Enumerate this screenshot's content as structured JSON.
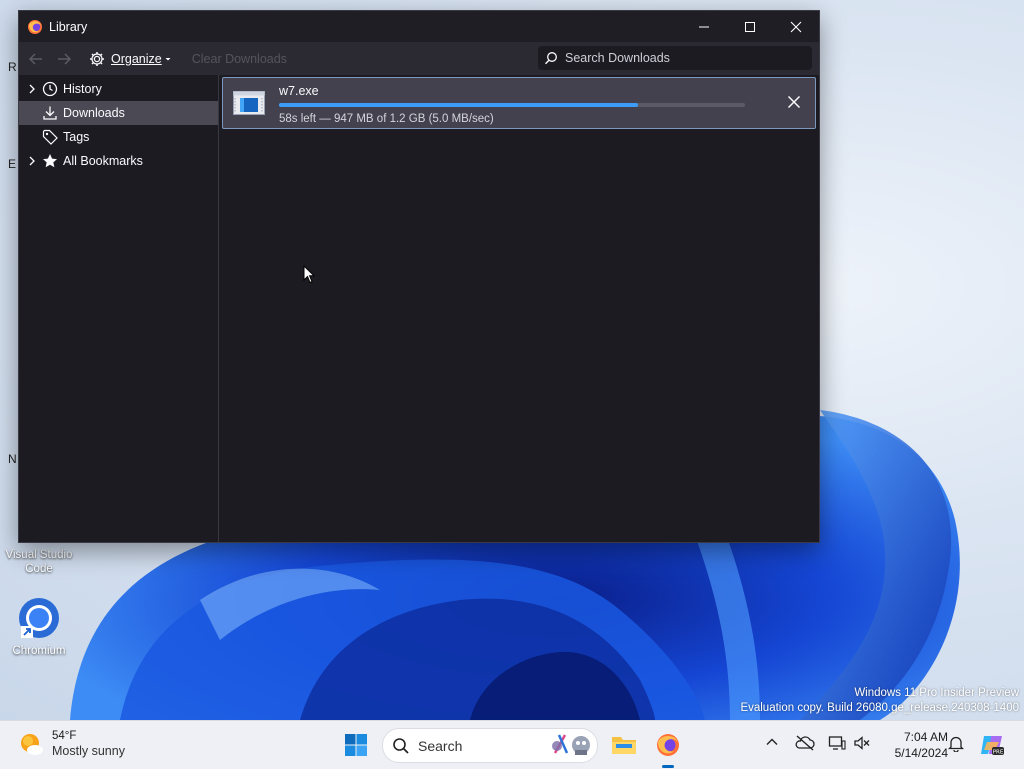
{
  "window": {
    "title": "Library",
    "organize_label": "Organize",
    "clear_downloads_label": "Clear Downloads",
    "search_placeholder": "Search Downloads"
  },
  "sidebar": {
    "items": [
      {
        "label": "History",
        "icon": "clock-icon",
        "expandable": true,
        "selected": false
      },
      {
        "label": "Downloads",
        "icon": "download-icon",
        "expandable": false,
        "selected": true
      },
      {
        "label": "Tags",
        "icon": "tag-icon",
        "expandable": false,
        "selected": false
      },
      {
        "label": "All Bookmarks",
        "icon": "star-icon",
        "expandable": true,
        "selected": false
      }
    ]
  },
  "downloads": [
    {
      "filename": "w7.exe",
      "progress": 0.77,
      "status": "58s left — 947 MB of 1.2 GB (5.0 MB/sec)"
    }
  ],
  "desktop": {
    "icons": [
      {
        "label": "Visual Studio Code"
      },
      {
        "label": "Chromium"
      }
    ],
    "watermark_line1": "Windows 11 Pro Insider Preview",
    "watermark_line2": "Evaluation copy. Build 26080.ge_release.240308-1400",
    "edge_chars": [
      "R",
      "E",
      "N"
    ]
  },
  "taskbar": {
    "weather_temp": "54°F",
    "weather_desc": "Mostly sunny",
    "search_label": "Search",
    "time": "7:04 AM",
    "date": "5/14/2024"
  },
  "colors": {
    "accent": "#3d9df6",
    "window_bg": "#1c1b22",
    "toolbar_bg": "#2b2a33",
    "selected_bg": "#4a4954",
    "taskbar_bg": "#eef0f5"
  }
}
